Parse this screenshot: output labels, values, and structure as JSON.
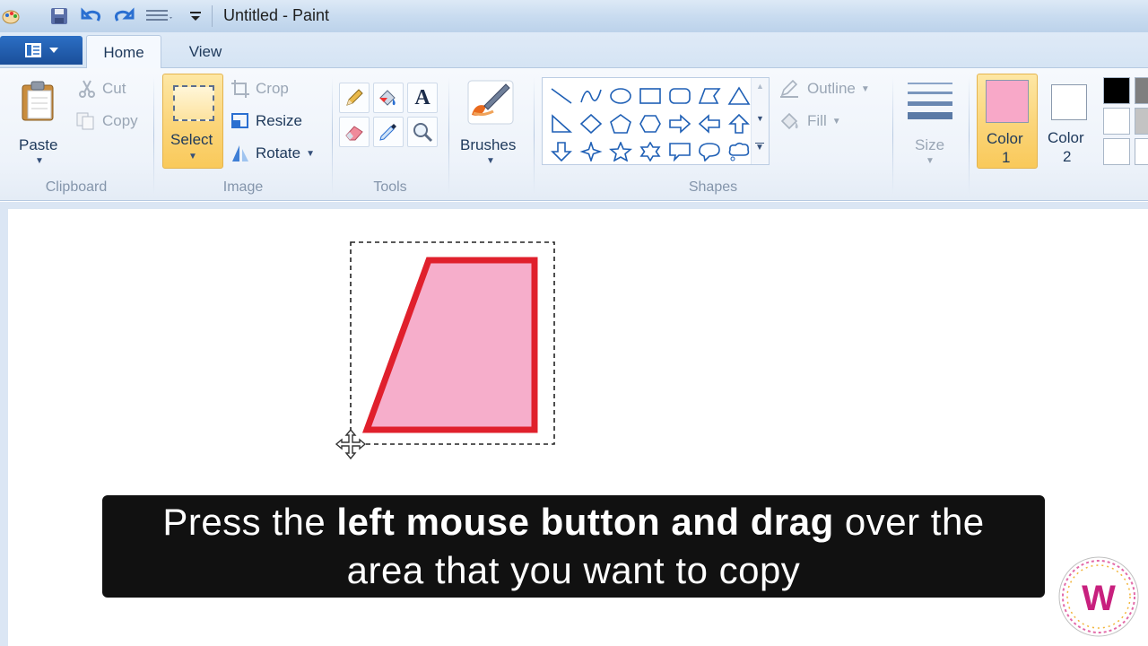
{
  "window": {
    "title": "Untitled - Paint"
  },
  "quick_access": {
    "icons": [
      "paint-app-icon",
      "save-icon",
      "undo-icon",
      "redo-icon",
      "properties-icon",
      "customize-icon"
    ]
  },
  "tabs": [
    {
      "label": "Home",
      "active": true
    },
    {
      "label": "View",
      "active": false
    }
  ],
  "clipboard": {
    "paste": "Paste",
    "cut": "Cut",
    "copy": "Copy",
    "group": "Clipboard"
  },
  "image": {
    "select": "Select",
    "crop": "Crop",
    "resize": "Resize",
    "rotate": "Rotate",
    "group": "Image"
  },
  "tools": {
    "group": "Tools",
    "items": [
      "pencil-icon",
      "fill-bucket-icon",
      "text-icon",
      "eraser-icon",
      "color-picker-icon",
      "magnifier-icon"
    ]
  },
  "brushes": {
    "label": "Brushes"
  },
  "shapes": {
    "group": "Shapes",
    "outline": "Outline",
    "fill": "Fill"
  },
  "size": {
    "label": "Size"
  },
  "colors": {
    "color1_line1": "Color",
    "color1_line2": "1",
    "color2_line1": "Color",
    "color2_line2": "2",
    "color1_value": "#f8a8c8",
    "color2_value": "#ffffff"
  },
  "palette": [
    "#000000",
    "#7f7f7f",
    "#ffffff",
    "#c3c3c3",
    "#ffffff",
    "#ffffff"
  ],
  "drawing": {
    "shape": "trapezoid",
    "fill_color": "#f6aecb",
    "outline_color": "#e0202c"
  },
  "caption": {
    "part1": "Press the ",
    "bold": "left mouse button and drag",
    "part2": " over the",
    "line2": "area that you want to copy"
  },
  "watermark": {
    "letter": "W"
  }
}
